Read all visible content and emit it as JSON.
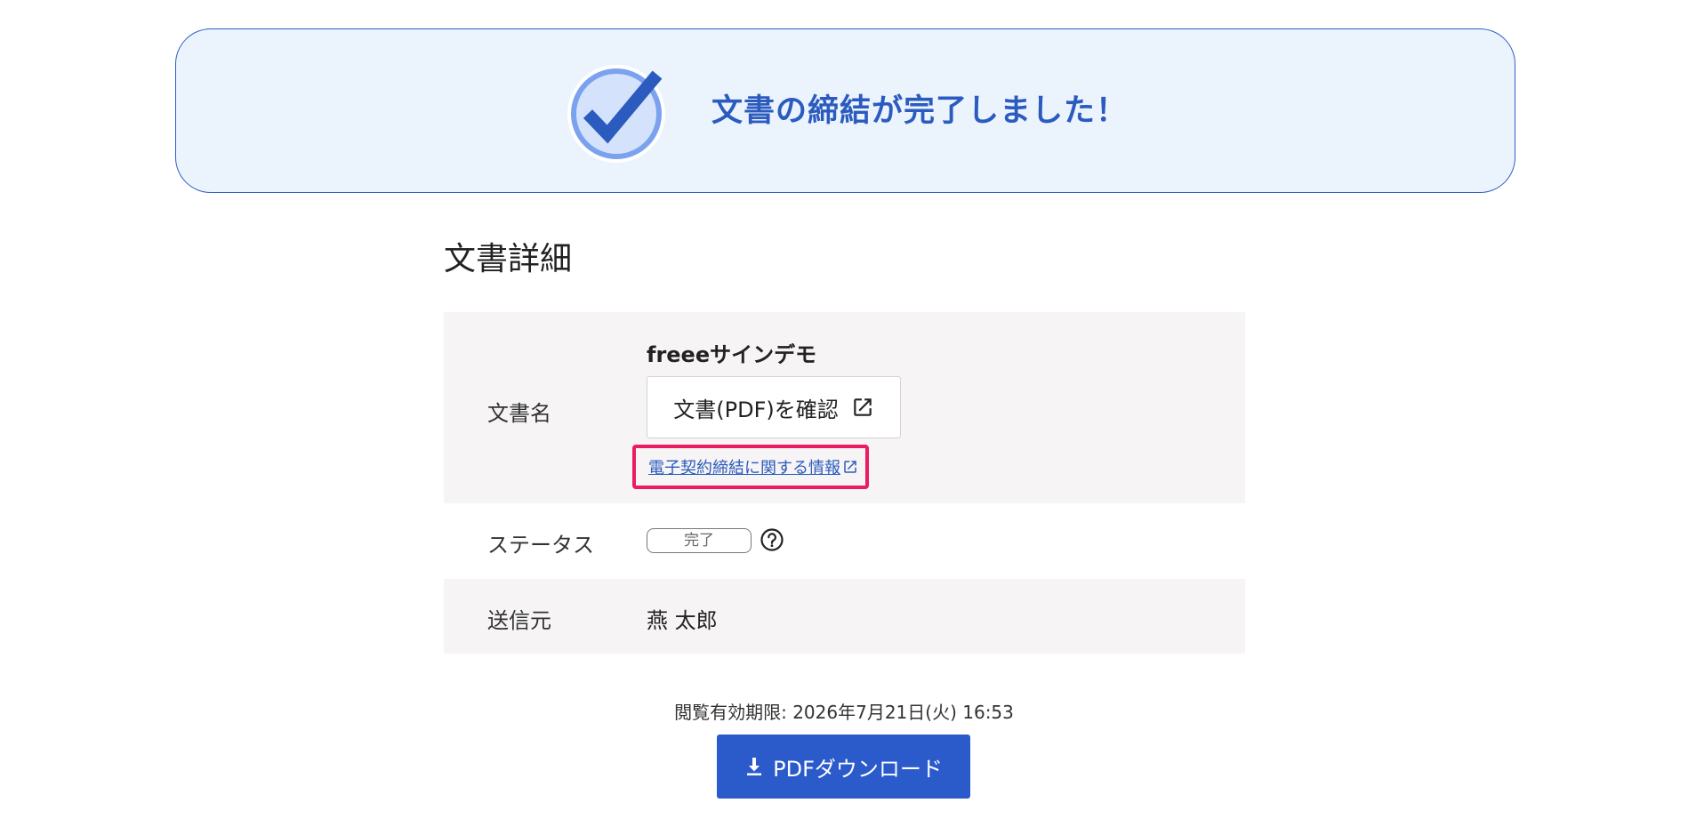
{
  "banner": {
    "message": "文書の締結が完了しました！",
    "icon": "check-circle-icon"
  },
  "section": {
    "title": "文書詳細"
  },
  "details": {
    "document_name": {
      "label": "文書名",
      "value": "freeeサインデモ",
      "view_pdf_label": "文書(PDF)を確認",
      "info_link_label": "電子契約締結に関する情報"
    },
    "status": {
      "label": "ステータス",
      "value": "完了"
    },
    "sender": {
      "label": "送信元",
      "value": "燕 太郎"
    }
  },
  "footer": {
    "expiry": "閲覧有効期限: 2026年7月21日(火) 16:53",
    "download_label": "PDFダウンロード"
  },
  "colors": {
    "accent": "#2b5bcb",
    "banner_bg": "#ebf3fd",
    "highlight": "#ea1c63"
  }
}
